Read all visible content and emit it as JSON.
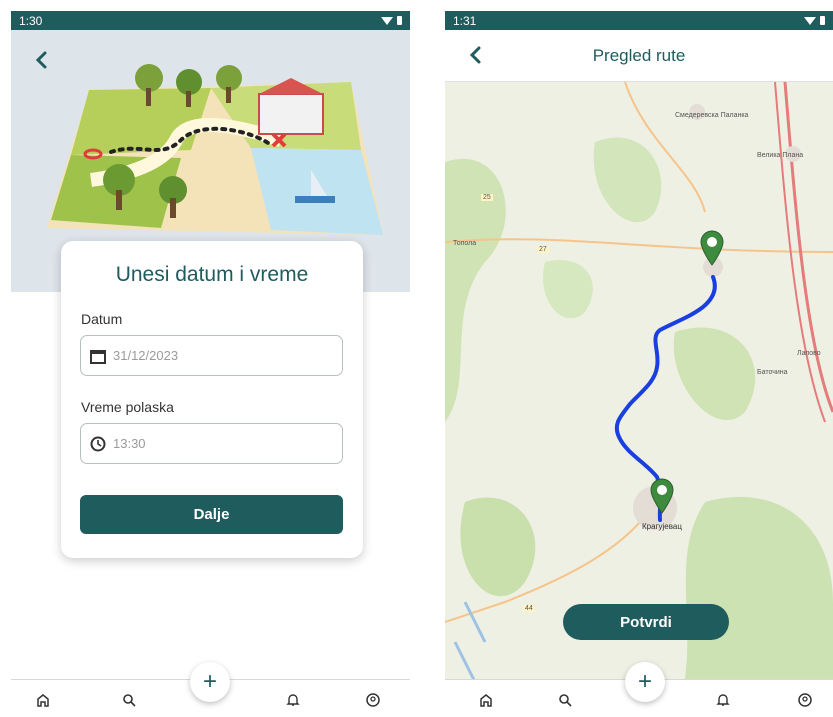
{
  "screen_left": {
    "status_time": "1:30",
    "card": {
      "title": "Unesi datum i vreme",
      "date_label": "Datum",
      "date_value": "31/12/2023",
      "time_label": "Vreme polaska",
      "time_value": "13:30",
      "next_button": "Dalje"
    }
  },
  "screen_right": {
    "status_time": "1:31",
    "title": "Pregled rute",
    "confirm_button": "Potvrdi",
    "map_labels": {
      "town_north": "Смедеревска Паланка",
      "town_ne": "Велика Плана",
      "town_west": "Топола",
      "town_east": "Лапово",
      "town_e2": "Баточина",
      "city_south": "Крагујевац",
      "road_a": "27",
      "road_b": "25",
      "road_c": "44"
    }
  },
  "colors": {
    "primary": "#1f5c5e",
    "route": "#1a3fe0",
    "marker": "#3e8a3e"
  },
  "icons": [
    "back-arrow-icon",
    "calendar-icon",
    "clock-icon",
    "home-icon",
    "search-icon",
    "plus-icon",
    "bell-icon",
    "profile-icon",
    "map-marker-icon"
  ]
}
